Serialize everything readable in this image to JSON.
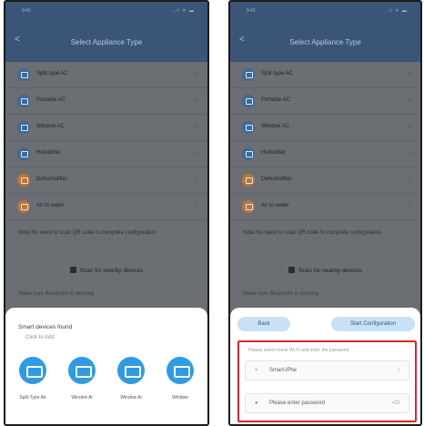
{
  "status": {
    "time": "9:41",
    "signal": "..ıl ᯤ ▬"
  },
  "header": {
    "back": "<",
    "title": "Select Appliance Type"
  },
  "appliances": [
    {
      "label": "Split-type AC",
      "icon": "split-ac-icon"
    },
    {
      "label": "Portable AC",
      "icon": "portable-ac-icon"
    },
    {
      "label": "Window AC",
      "icon": "window-ac-icon"
    },
    {
      "label": "Humidifier",
      "icon": "humidifier-icon"
    },
    {
      "label": "Dehumidifier",
      "icon": "dehumidifier-icon"
    },
    {
      "label": "Air to water",
      "icon": "air-to-water-icon"
    }
  ],
  "note": "Note:No need to scan QR code to complete configuration",
  "scan_label": "Scan for nearby devices",
  "bluetooth_note": "Make sure Bluetooth is working",
  "left_sheet": {
    "title": "Smart devices found",
    "subtitle": "Click to Add",
    "devices": [
      "Split-Type Air",
      "Window Ai",
      "Window Ai",
      "Window"
    ]
  },
  "right_sheet": {
    "back_label": "Back",
    "start_label": "Start Configuration",
    "hint": "Please select home Wi-Fi and enter the password",
    "wifi_name": "Smart-iPhe",
    "password_placeholder": "Please enter password",
    "toggle_label": "<O"
  },
  "colors": {
    "header": "#3a5577",
    "accent": "#2f9be2",
    "highlight": "#d9262f"
  }
}
